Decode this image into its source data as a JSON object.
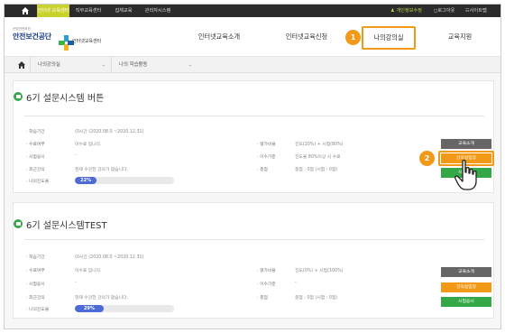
{
  "topbar": {
    "tabs": [
      "인터넷 교육센터",
      "직무교육센터",
      "집체교육",
      "관리자시스템"
    ],
    "right": [
      "개인정보수정",
      "로그아웃",
      "사이트맵"
    ]
  },
  "header": {
    "logo_small": "산업안전보건",
    "logo_big": "안전보건공단",
    "logo_sub": "인터넷교육센터",
    "nav": [
      "인터넷교육소개",
      "인터넷교육신청",
      "나의강의실",
      "교육지원"
    ],
    "badge_1": "1",
    "badge_2": "2"
  },
  "breadcrumb": {
    "level1": "나의강의실",
    "level2": "나의 학습활동"
  },
  "courses": [
    {
      "title": "6기 설문시스템 버튼",
      "period_label": "학습기간",
      "period_value": "(0시간 (2020.08.0 ~2020.12.31)",
      "review_label": "수료여부",
      "review_value": "미수료 입니다.",
      "exam_label": "시험응시",
      "exam_value": "-",
      "recent_label": "최근강의",
      "recent_value": "현재 수강한 강의가 없습니다.",
      "progress_label": "나의진도율",
      "progress_value": "22%",
      "progress_pct": 22,
      "eval_label": "평가비율",
      "eval_value": "진도(20%) + 시험(80%)",
      "criteria_label": "이수기준",
      "criteria_value": "진도율 80%이상 시 수료",
      "total_label": "총점",
      "total_value": "총점 : 0점 (시험 : 0점)",
      "buttons": [
        "교육소개",
        "강의실입장",
        "시험응시"
      ]
    },
    {
      "title": "6기 설문시스템TEST",
      "period_label": "학습기간",
      "period_value": "(0시간 (2020.08.0 ~2020.12.31)",
      "review_label": "수료여부",
      "review_value": "미수료 입니다.",
      "exam_label": "시험응시",
      "exam_value": "-",
      "recent_label": "최근강의",
      "recent_value": "현재 수강한 강의가 없습니다.",
      "progress_label": "나의진도율",
      "progress_value": "29%",
      "progress_pct": 29,
      "eval_label": "평가비율",
      "eval_value": "진도(0%) + 시험(100%)",
      "criteria_label": "이수기준",
      "criteria_value": "-",
      "total_label": "총점",
      "total_value": "총점 : 0점 (시험 : 0점)",
      "buttons": [
        "교육소개",
        "강의실입장",
        "시험응시"
      ]
    }
  ],
  "colors": {
    "accent_orange": "#f29a18",
    "progress_blue": "#4d6bd6",
    "green": "#34a846",
    "topbar_dark": "#2b2b2b",
    "topbar_active": "#c8d32c"
  }
}
